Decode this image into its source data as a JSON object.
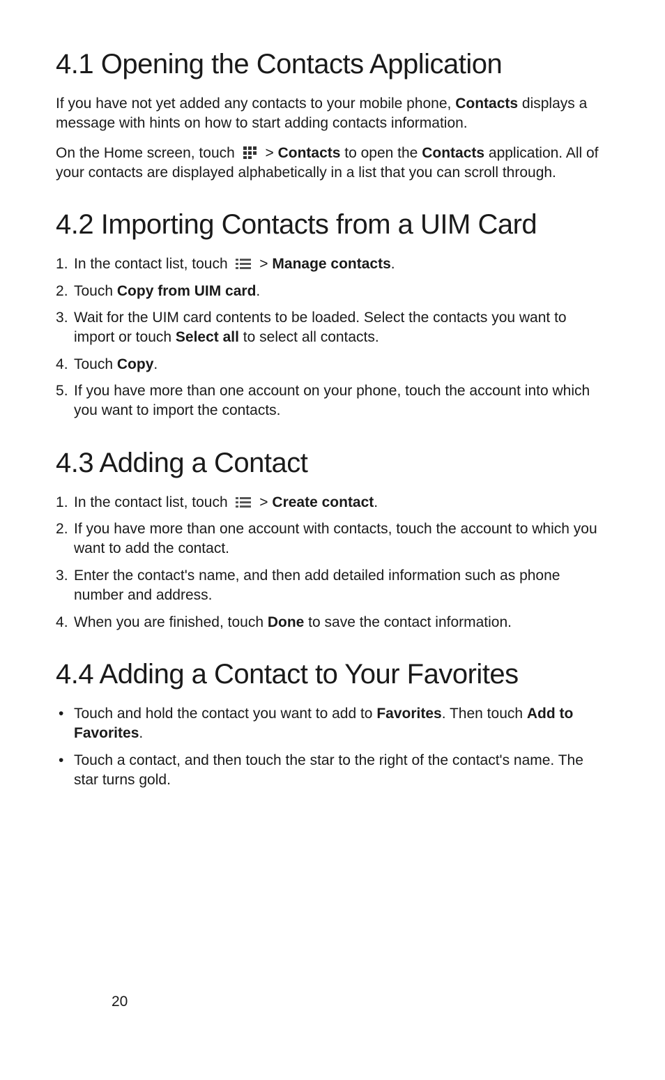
{
  "sections": {
    "s41": {
      "heading": "4.1  Opening the Contacts Application",
      "p1_pre": "If  you have not yet added any contacts to your mobile phone, ",
      "p1_bold1": "Contacts",
      "p1_post": " displays a message with hints on how to start adding contacts information.",
      "p2_pre": "On the Home screen, touch ",
      "p2_mid1": "  > ",
      "p2_bold1": "Contacts",
      "p2_mid2": " to open the ",
      "p2_bold2": "Contacts",
      "p2_post": " application. All of your contacts are displayed alphabetically in a list that you can scroll through."
    },
    "s42": {
      "heading": "4.2  Importing Contacts from a UIM Card",
      "li1_pre": "In the contact list, touch ",
      "li1_mid": "  > ",
      "li1_bold": "Manage contacts",
      "li1_post": ".",
      "li2_pre": "Touch ",
      "li2_bold": "Copy from UIM card",
      "li2_post": ".",
      "li3_pre": "Wait for the UIM card contents to be loaded. Select the contacts you want to import or touch ",
      "li3_bold": "Select all",
      "li3_post": " to select all contacts.",
      "li4_pre": "Touch ",
      "li4_bold": "Copy",
      "li4_post": ".",
      "li5": "If you have more than one account on your phone, touch the account into which you want to import the contacts."
    },
    "s43": {
      "heading": "4.3  Adding a Contact",
      "li1_pre": "In the contact list, touch ",
      "li1_mid": "  > ",
      "li1_bold": "Create contact",
      "li1_post": ".",
      "li2": "If you have more than one account with contacts, touch the account to which you want to add the contact.",
      "li3": "Enter the contact's name, and then add detailed information such as phone number and address.",
      "li4_pre": "When you are finished, touch ",
      "li4_bold": "Done",
      "li4_post": " to save the contact information."
    },
    "s44": {
      "heading": "4.4  Adding a Contact to Your Favorites",
      "li1_pre": "Touch and hold the contact you want to add to ",
      "li1_bold1": "Favorites",
      "li1_mid": ". Then touch ",
      "li1_bold2": "Add to Favorites",
      "li1_post": ".",
      "li2": "Touch a contact, and then touch the star to the right of the contact's name. The star turns gold."
    }
  },
  "page_number": "20"
}
